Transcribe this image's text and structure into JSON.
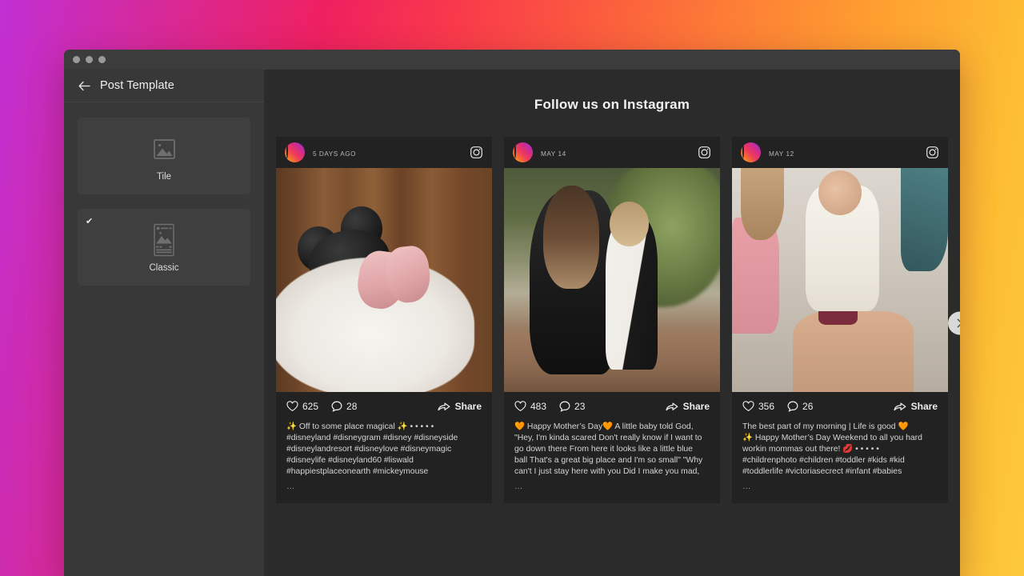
{
  "window": {
    "traffic_lights": [
      "close",
      "minimize",
      "maximize"
    ]
  },
  "sidebar": {
    "back_icon": "arrow-left-icon",
    "title": "Post Template",
    "templates": [
      {
        "label": "Tile",
        "icon": "image-placeholder-icon",
        "selected": false
      },
      {
        "label": "Classic",
        "icon": "post-card-icon",
        "selected": true
      }
    ],
    "check_glyph": "✔"
  },
  "main": {
    "title": "Follow us on Instagram",
    "next_icon": "chevron-right-icon",
    "posts": [
      {
        "date": "5 DAYS AGO",
        "badge_icon": "instagram-icon",
        "avatar_name": "avatar",
        "likes": "625",
        "comments": "28",
        "share_label": "Share",
        "caption_lines": [
          "✨ Off to some place magical ✨  • • • • •",
          "#disneyland #disneygram #disney #disneyside",
          "#disneylandresort #disneylove #disneymagic",
          "#disneylife #disneyland60 #liswald",
          "#happiestplaceonearth #mickeymouse"
        ],
        "ellipsis": "…",
        "image_alt": "mickey-ears-hat-and-pink-baby-shoes"
      },
      {
        "date": "MAY 14",
        "badge_icon": "instagram-icon",
        "avatar_name": "avatar",
        "likes": "483",
        "comments": "23",
        "share_label": "Share",
        "caption_lines": [
          "🧡 Happy Mother’s Day🧡  A little baby told God,",
          "\"Hey, I'm kinda scared Don't really know if I want to",
          "go down there From here it looks like a little blue",
          "ball That's a great big place and I'm so small\" \"Why",
          "can't I just stay here with you Did I make you mad,"
        ],
        "ellipsis": "…",
        "image_alt": "mother-kissing-toddler"
      },
      {
        "date": "MAY 12",
        "badge_icon": "instagram-icon",
        "avatar_name": "avatar",
        "likes": "356",
        "comments": "26",
        "share_label": "Share",
        "caption_lines": [
          "The best part of my morning | Life is good 🧡",
          "✨  Happy Mother’s Day Weekend to all you hard",
          "workin mommas out there! 💋  • • • • •",
          "#childrenphoto #children #toddler #kids #kid",
          "#toddlerlife #victoriasecrect #infant #babies"
        ],
        "ellipsis": "…",
        "image_alt": "toddler-sitting-on-mothers-lap"
      }
    ]
  },
  "colors": {
    "backdrop_start": "#c12fd4",
    "backdrop_mid": "#ef2060",
    "backdrop_end": "#fdc93a",
    "sidebar_bg": "#383838",
    "main_bg": "#2b2b2b",
    "card_bg": "#222222",
    "text_primary": "#f2f2f2",
    "text_muted": "#b6b6b6"
  }
}
